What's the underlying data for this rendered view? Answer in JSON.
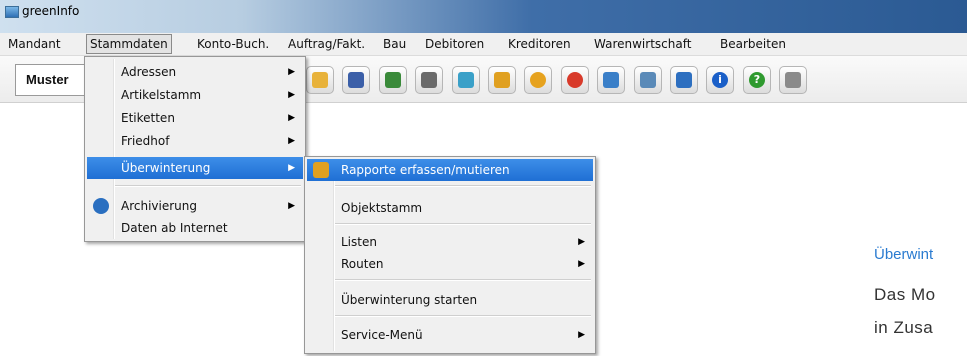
{
  "window": {
    "title": "greenInfo"
  },
  "menubar": {
    "items": [
      "Mandant",
      "Stammdaten",
      "Konto-Buch.",
      "Auftrag/Fakt.",
      "Bau",
      "Debitoren",
      "Kreditoren",
      "Warenwirtschaft",
      "Bearbeiten"
    ],
    "active": "Stammdaten"
  },
  "toolbar": {
    "mandant_value": "Muster",
    "buttons": [
      {
        "icon": "notebook-icon",
        "color": "#e8b23a"
      },
      {
        "icon": "book-icon",
        "color": "#3b5fa8"
      },
      {
        "icon": "green-book-icon",
        "color": "#3a8a3a"
      },
      {
        "icon": "binoculars-icon",
        "color": "#6a6a6a"
      },
      {
        "icon": "house-icon",
        "color": "#3aa0c8"
      },
      {
        "icon": "clipboard-icon",
        "color": "#e0a020"
      },
      {
        "icon": "lightbulb-icon",
        "color": "#e6a21e"
      },
      {
        "icon": "pin-icon",
        "color": "#d83a2a"
      },
      {
        "icon": "car-icon",
        "color": "#3a7fc8"
      },
      {
        "icon": "document-icon",
        "color": "#5a8ab8"
      },
      {
        "icon": "calculator-icon",
        "color": "#2d6fc0"
      },
      {
        "icon": "info-icon",
        "color": "#1a5fc8"
      },
      {
        "icon": "help-icon",
        "color": "#2f9a2f"
      },
      {
        "icon": "printer-icon",
        "color": "#8a8a8a"
      }
    ]
  },
  "stammdaten_menu": {
    "items": [
      {
        "label": "Adressen",
        "submenu": true
      },
      {
        "label": "Artikelstamm",
        "submenu": true
      },
      {
        "label": "Etiketten",
        "submenu": true
      },
      {
        "label": "Friedhof",
        "submenu": true
      },
      {
        "label": "Überwinterung",
        "submenu": true,
        "highlighted": true
      },
      {
        "label": "Archivierung",
        "submenu": true,
        "icon": "archive-icon"
      },
      {
        "label": "Daten ab Internet",
        "submenu": false
      }
    ]
  },
  "ueberwinterung_menu": {
    "items": [
      {
        "label": "Rapporte erfassen/mutieren",
        "highlighted": true,
        "icon": "clipboard-icon"
      },
      {
        "label": "Objektstamm"
      },
      {
        "label": "Listen",
        "submenu": true
      },
      {
        "label": "Routen",
        "submenu": true
      },
      {
        "label": "Überwinterung starten"
      },
      {
        "label": "Service-Menü",
        "submenu": true
      }
    ]
  },
  "side_panel": {
    "heading": "Überwint",
    "line1": "Das Mo",
    "line2": "in Zusa"
  }
}
